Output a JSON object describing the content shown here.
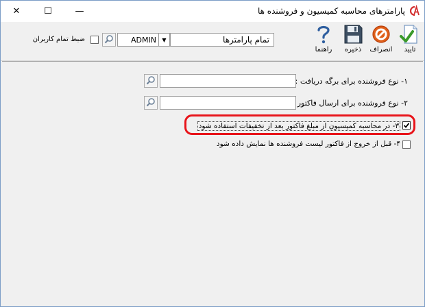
{
  "window": {
    "title": "پارامترهای محاسبه کمیسیون و فروشنده ها",
    "logo_icon": "cs-logo-icon",
    "controls": {
      "minimize": "—",
      "maximize": "☐",
      "close": "✕"
    }
  },
  "toolbar": {
    "confirm_label": "تایید",
    "cancel_label": "انصراف",
    "save_label": "ذخیره",
    "help_label": "راهنما",
    "confirm_icon": "document-check-icon",
    "cancel_icon": "no-entry-icon",
    "save_icon": "floppy-disk-icon",
    "help_icon": "question-icon"
  },
  "filters": {
    "parameters_value": "تمام پارامترها",
    "user_value": "ADMIN",
    "all_users_label": "ضبط تمام کاربران",
    "all_users_checked": false
  },
  "form": {
    "receipt_type_label": "۱- نوع فروشنده برای برگه دریافت :",
    "receipt_type_value": "",
    "invoice_type_label": "۲- نوع فروشنده برای ارسال فاکتور :",
    "invoice_type_value": "",
    "option3_label": "۳- در محاسبه کمیسیون از مبلغ فاکتور بعد از تخفیفات استفاده شود",
    "option3_checked": true,
    "option4_label": "۴- قبل از خروج از فاکتور لیست فروشنده ها نمایش داده شود",
    "option4_checked": false
  },
  "colors": {
    "highlight": "#e8141a",
    "logo": "#d32f2f",
    "cancel_icon": "#e0601a",
    "confirm_check": "#3a9a2a"
  }
}
